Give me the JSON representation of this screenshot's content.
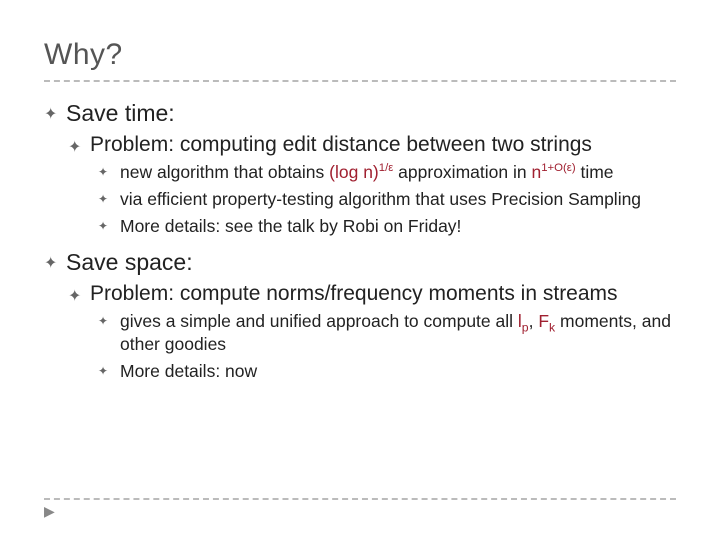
{
  "title": "Why?",
  "sections": [
    {
      "heading": "Save time:",
      "sub": [
        {
          "heading": "Problem: computing edit distance between two strings",
          "items": [
            {
              "pre": "new algorithm that obtains ",
              "hl1": "(log n)",
              "hl1sup": "1/ε",
              "mid": " approximation in ",
              "hl2": "n",
              "hl2sup": "1+O(ε)",
              "post": " time"
            },
            {
              "text": "via efficient property-testing algorithm that uses Precision Sampling"
            },
            {
              "text": "More details: see the talk by Robi on Friday!"
            }
          ]
        }
      ]
    },
    {
      "heading": "Save space:",
      "sub": [
        {
          "heading": "Problem: compute norms/frequency moments in streams",
          "items": [
            {
              "pre": "gives a simple and unified approach to compute all ",
              "hl1": "l",
              "hl1sub": "p",
              "mid": ", ",
              "hl2": "F",
              "hl2sub": "k",
              "post": " moments, and other goodies"
            },
            {
              "text": "More details: now"
            }
          ]
        }
      ]
    }
  ],
  "footArrow": "▶"
}
